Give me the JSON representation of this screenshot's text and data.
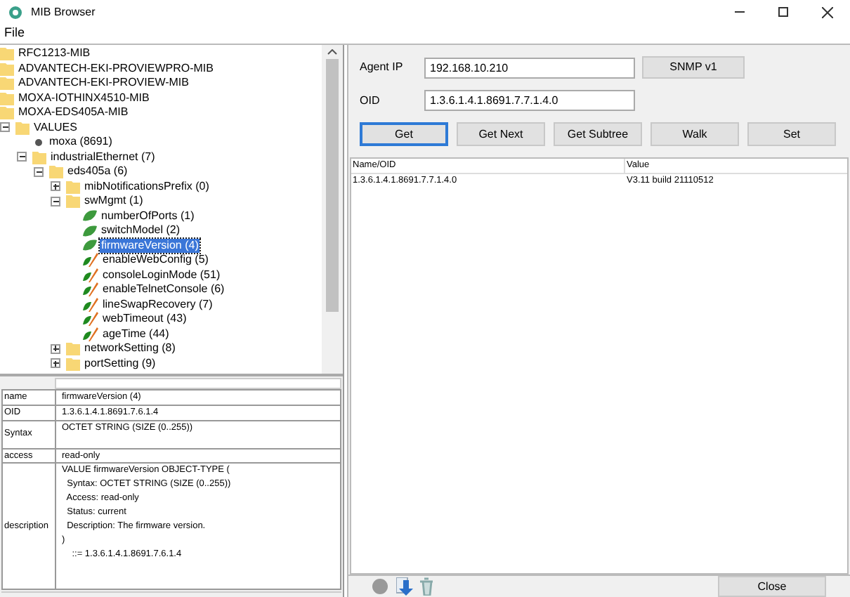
{
  "window": {
    "title": "MIB Browser"
  },
  "menu": [
    "File"
  ],
  "tree": [
    {
      "label": "RFC1213-MIB",
      "kind": "folder"
    },
    {
      "label": "ADVANTECH-EKI-PROVIEWPRO-MIB",
      "kind": "folder"
    },
    {
      "label": "ADVANTECH-EKI-PROVIEW-MIB",
      "kind": "folder"
    },
    {
      "label": "MOXA-IOTHINX4510-MIB",
      "kind": "folder"
    },
    {
      "label": "MOXA-EDS405A-MIB",
      "kind": "folder"
    },
    {
      "label": "VALUES",
      "kind": "folder",
      "expanded": true,
      "children": [
        {
          "label": "moxa (8691)",
          "kind": "node"
        },
        {
          "label": "industrialEthernet (7)",
          "kind": "folder",
          "expanded": true,
          "children": [
            {
              "label": "eds405a (6)",
              "kind": "folder",
              "expanded": true,
              "children": [
                {
                  "label": "mibNotificationsPrefix (0)",
                  "kind": "folder",
                  "expanded": false
                },
                {
                  "label": "swMgmt (1)",
                  "kind": "folder",
                  "expanded": true,
                  "children": [
                    {
                      "label": "numberOfPorts (1)",
                      "kind": "leaf",
                      "selected": false
                    },
                    {
                      "label": "switchModel (2)",
                      "kind": "leaf",
                      "selected": false
                    },
                    {
                      "label": "firmwareVersion (4)",
                      "kind": "leaf",
                      "selected": true
                    },
                    {
                      "label": "enableWebConfig (5)",
                      "kind": "writable",
                      "selected": false
                    },
                    {
                      "label": "consoleLoginMode (51)",
                      "kind": "writable",
                      "selected": false
                    },
                    {
                      "label": "enableTelnetConsole (6)",
                      "kind": "writable",
                      "selected": false
                    },
                    {
                      "label": "lineSwapRecovery (7)",
                      "kind": "writable",
                      "selected": false
                    },
                    {
                      "label": "webTimeout (43)",
                      "kind": "writable",
                      "selected": false
                    },
                    {
                      "label": "ageTime (44)",
                      "kind": "writable",
                      "selected": false
                    }
                  ]
                },
                {
                  "label": "networkSetting (8)",
                  "kind": "folder",
                  "expanded": false
                },
                {
                  "label": "portSetting (9)",
                  "kind": "folder",
                  "expanded": false
                }
              ]
            }
          ]
        }
      ]
    }
  ],
  "details": [
    {
      "name": "name",
      "value": "firmwareVersion (4)"
    },
    {
      "name": "OID",
      "value": "1.3.6.1.4.1.8691.7.6.1.4"
    },
    {
      "name": "Syntax",
      "value": "OCTET STRING (SIZE (0..255))"
    },
    {
      "name": "access",
      "value": "read-only"
    },
    {
      "name": "description",
      "lines": [
        "VALUE firmwareVersion OBJECT-TYPE (",
        "  Syntax: OCTET STRING (SIZE (0..255))",
        "  Access: read-only",
        "  Status: current",
        "  Description: The firmware version.",
        ")",
        "    ::= 1.3.6.1.4.1.8691.7.6.1.4"
      ]
    }
  ],
  "agent_ip": {
    "label": "Agent IP",
    "value": "192.168.10.210"
  },
  "version_button": "SNMP v1",
  "oid": {
    "label": "OID",
    "value": "1.3.6.1.4.1.8691.7.7.1.4.0"
  },
  "actions": [
    {
      "label": "Get",
      "selected": true
    },
    {
      "label": "Get Next",
      "selected": false
    },
    {
      "label": "Get Subtree",
      "selected": false
    },
    {
      "label": "Walk",
      "selected": false
    },
    {
      "label": "Set",
      "selected": false
    }
  ],
  "results": {
    "columns": [
      "Name/OID",
      "Value"
    ],
    "rows": [
      [
        "1.3.6.1.4.1.8691.7.7.1.4.0",
        "V3.11 build 21110512"
      ]
    ]
  },
  "close_button": "Close"
}
